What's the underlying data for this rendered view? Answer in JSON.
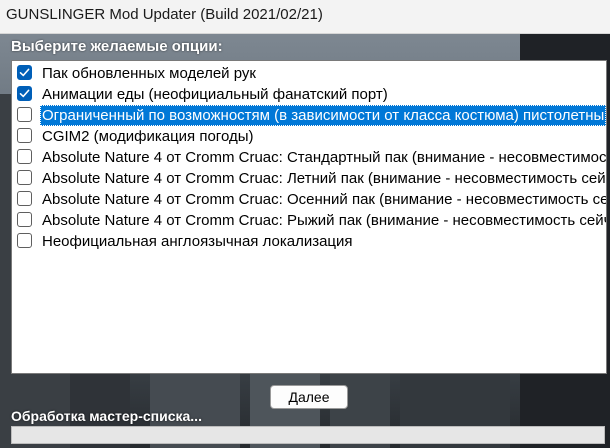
{
  "window": {
    "title": "GUNSLINGER Mod Updater (Build 2021/02/21)"
  },
  "heading": "Выберите желаемые опции:",
  "options": [
    {
      "label": "Пак обновленных моделей рук",
      "checked": true,
      "selected": false
    },
    {
      "label": "Анимации еды (неофициальный фанатский порт)",
      "checked": true,
      "selected": false
    },
    {
      "label": "Ограниченный по возможностям (в зависимости от класса костюма) пистолетны",
      "checked": false,
      "selected": true
    },
    {
      "label": "CGIM2 (модификация погоды)",
      "checked": false,
      "selected": false
    },
    {
      "label": "Absolute Nature 4 от Cromm Cruac: Стандартный пак (внимание - несовместимост",
      "checked": false,
      "selected": false
    },
    {
      "label": "Absolute Nature 4 от Cromm Cruac: Летний пак (внимание - несовместимость сей",
      "checked": false,
      "selected": false
    },
    {
      "label": "Absolute Nature 4 от Cromm Cruac: Осенний пак (внимание - несовместимость се",
      "checked": false,
      "selected": false
    },
    {
      "label": "Absolute Nature 4 от Cromm Cruac: Рыжий пак (внимание - несовместимость сейч",
      "checked": false,
      "selected": false
    },
    {
      "label": "Неофициальная англоязычная локализация",
      "checked": false,
      "selected": false
    }
  ],
  "next_button": "Далее",
  "status_text": "Обработка мастер-списка...",
  "progress": 0,
  "colors": {
    "selection": "#0078d7",
    "checkbox_checked": "#005fb8"
  }
}
